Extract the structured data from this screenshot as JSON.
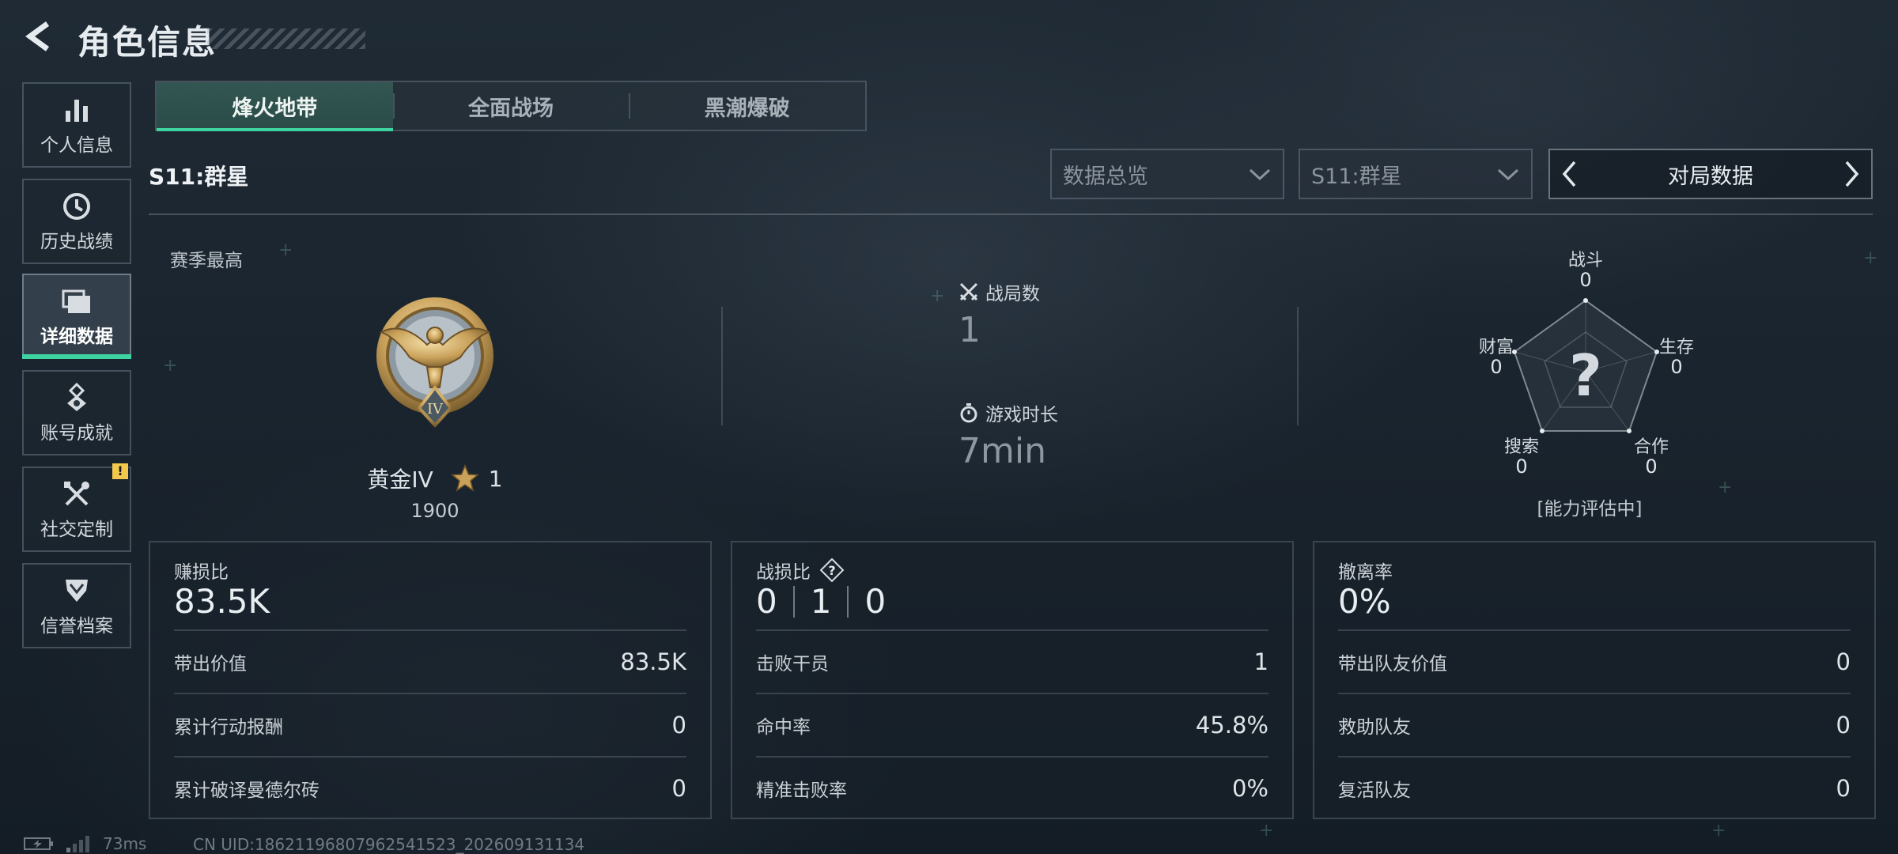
{
  "header": {
    "title": "角色信息"
  },
  "sidebar": {
    "items": [
      {
        "label": "个人信息",
        "icon": "bar-chart-icon"
      },
      {
        "label": "历史战绩",
        "icon": "clock-icon"
      },
      {
        "label": "详细数据",
        "icon": "folders-icon",
        "active": true
      },
      {
        "label": "账号成就",
        "icon": "medal-icon"
      },
      {
        "label": "社交定制",
        "icon": "tools-icon",
        "badge": "!"
      },
      {
        "label": "信誉档案",
        "icon": "shield-icon"
      }
    ]
  },
  "mode_tabs": [
    {
      "label": "烽火地带",
      "active": true
    },
    {
      "label": "全面战场"
    },
    {
      "label": "黑潮爆破"
    }
  ],
  "season": {
    "label": "S11:群星"
  },
  "filters": {
    "overview": "数据总览",
    "season": "S11:群星",
    "match_data": "对局数据"
  },
  "overview": {
    "season_best_label": "赛季最高",
    "rank_name": "黄金IV",
    "rank_tier_numeral": "IV",
    "stars": "1",
    "rank_score": "1900",
    "matches_label": "战局数",
    "matches_value": "1",
    "playtime_label": "游戏时长",
    "playtime_value": "7min"
  },
  "radar": {
    "labels": {
      "combat": {
        "name": "战斗",
        "value": "0"
      },
      "survival": {
        "name": "生存",
        "value": "0"
      },
      "cooperation": {
        "name": "合作",
        "value": "0"
      },
      "search": {
        "name": "搜索",
        "value": "0"
      },
      "wealth": {
        "name": "财富",
        "value": "0"
      }
    },
    "center_mark": "?",
    "status": "[能力评估中]"
  },
  "cards": {
    "profit": {
      "title": "赚损比",
      "big": "83.5K",
      "rows": [
        {
          "k": "带出价值",
          "v": "83.5K"
        },
        {
          "k": "累计行动报酬",
          "v": "0"
        },
        {
          "k": "累计破译曼德尔砖",
          "v": "0"
        }
      ]
    },
    "kd": {
      "title": "战损比",
      "help": "?",
      "big_parts": [
        "0",
        "1",
        "0"
      ],
      "rows": [
        {
          "k": "击败干员",
          "v": "1"
        },
        {
          "k": "命中率",
          "v": "45.8%"
        },
        {
          "k": "精准击败率",
          "v": "0%"
        }
      ]
    },
    "extract": {
      "title": "撤离率",
      "big": "0%",
      "rows": [
        {
          "k": "带出队友价值",
          "v": "0"
        },
        {
          "k": "救助队友",
          "v": "0"
        },
        {
          "k": "复活队友",
          "v": "0"
        }
      ]
    }
  },
  "status_bar": {
    "ping": "73ms",
    "uid": "CN UID:186211968079625415​23_202609131134"
  },
  "colors": {
    "accent": "#3ed4a2",
    "gold": "#c9a15a",
    "warn": "#f2c94c"
  }
}
